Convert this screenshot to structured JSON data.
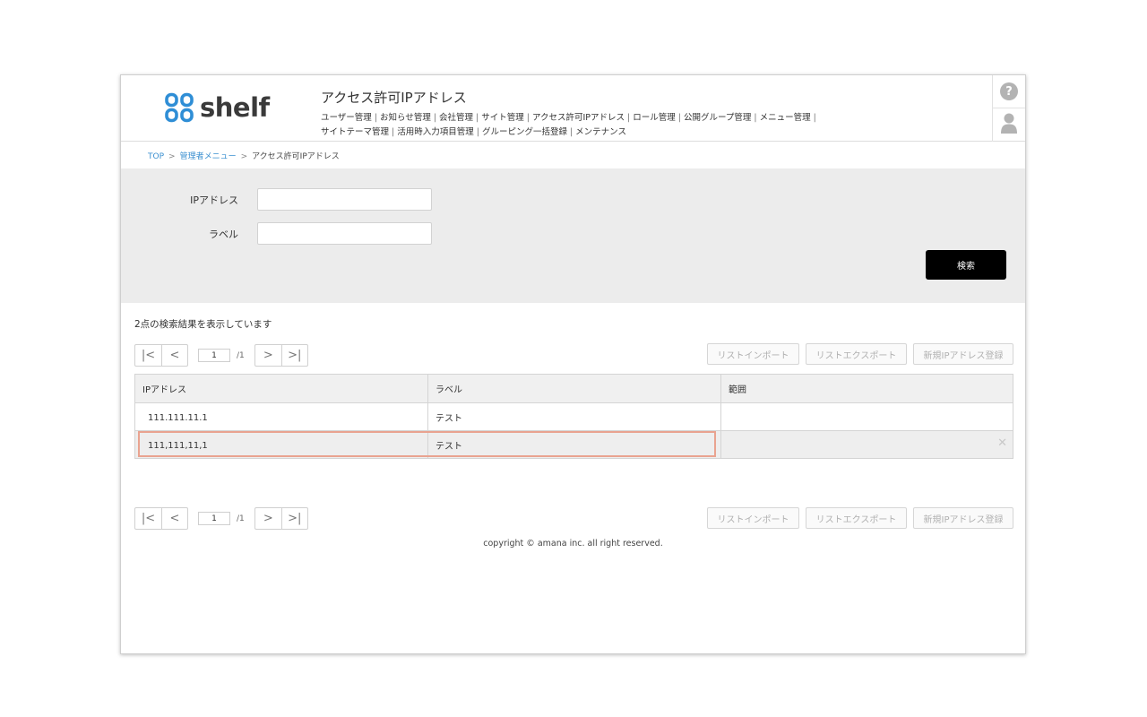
{
  "app": {
    "logo_text": "shelf"
  },
  "header": {
    "title": "アクセス許可IPアドレス",
    "menu": [
      "ユーザー管理",
      "お知らせ管理",
      "会社管理",
      "サイト管理",
      "アクセス許可IPアドレス",
      "ロール管理",
      "公開グループ管理",
      "メニュー管理",
      "サイトテーマ管理",
      "活用時入力項目管理",
      "グルーピング一括登録",
      "メンテナンス"
    ],
    "menu_separator": "|",
    "help_symbol": "?"
  },
  "breadcrumb": {
    "top": "TOP",
    "admin_menu": "管理者メニュー",
    "current": "アクセス許可IPアドレス",
    "arrow": ">"
  },
  "search": {
    "ip_label": "IPアドレス",
    "ip_value": "",
    "label_label": "ラベル",
    "label_value": "",
    "search_button": "検索"
  },
  "results": {
    "count_text": "2点の検索結果を表示しています"
  },
  "pager": {
    "first": "|<",
    "prev": "<",
    "next": ">",
    "last": ">|",
    "current_page": "1",
    "total_pages": "/1"
  },
  "actions": {
    "import": "リストインポート",
    "export": "リストエクスポート",
    "register": "新規IPアドレス登録"
  },
  "table": {
    "headers": [
      "IPアドレス",
      "ラベル",
      "範囲"
    ],
    "rows": [
      {
        "ip": "111.111.11.1",
        "label": "テスト",
        "range": ""
      },
      {
        "ip": "111,111,11,1",
        "label": "テスト",
        "range": ""
      }
    ],
    "delete_symbol": "✕"
  },
  "footer": {
    "copyright": "copyright © amana inc. all right reserved."
  },
  "colors": {
    "logo_blue": "#2f8ed6",
    "link_blue": "#3a8fd0",
    "panel_bg": "#ececec",
    "search_button_bg": "#000000",
    "selection_outline": "#e9a390"
  }
}
